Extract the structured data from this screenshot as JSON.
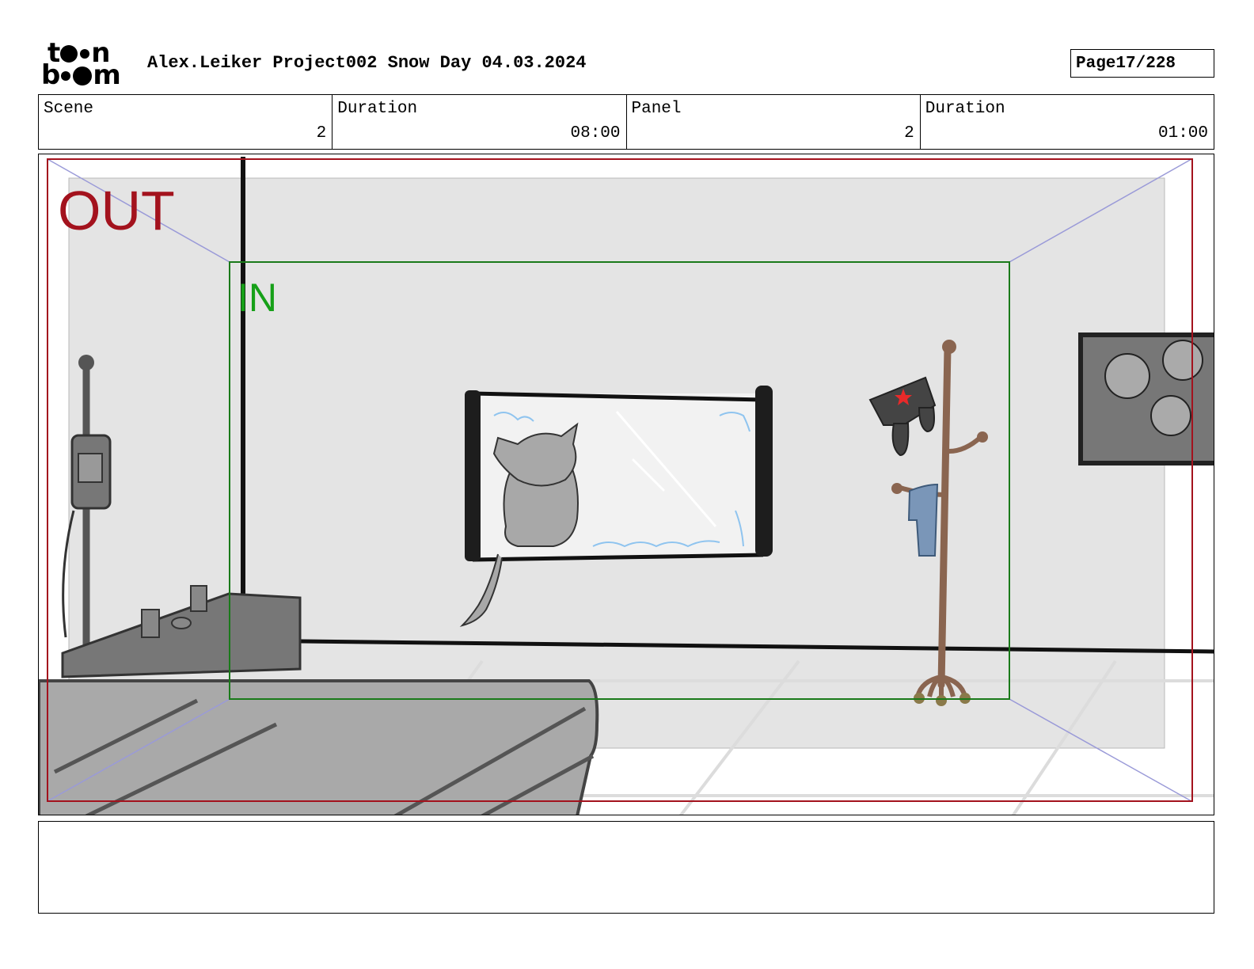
{
  "header": {
    "logo_top": "t",
    "logo_top_end": "n",
    "logo_bottom": "b",
    "logo_bottom_end": "m",
    "title": "Alex.Leiker Project002 Snow Day 04.03.2024",
    "page_label": "Page",
    "page_value": "17/228"
  },
  "info": {
    "scene_label": "Scene",
    "scene_value": "2",
    "duration_label": "Duration",
    "duration_value": "08:00",
    "panel_label": "Panel",
    "panel_value": "2",
    "panel_duration_label": "Duration",
    "panel_duration_value": "01:00"
  },
  "frame": {
    "out_label": "OUT",
    "in_label": "IN",
    "out_color": "#a3121d",
    "in_color": "#16a018"
  },
  "notes": {
    "text": ""
  }
}
